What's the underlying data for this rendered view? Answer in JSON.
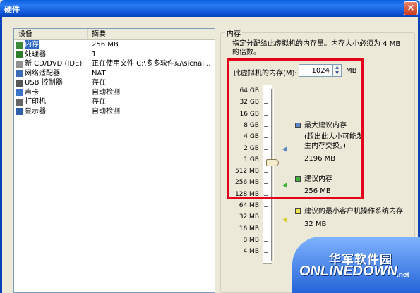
{
  "window": {
    "title": "硬件",
    "close_glyph": "×"
  },
  "device_list": {
    "headers": {
      "device": "设备",
      "summary": "摘要"
    },
    "rows": [
      {
        "icon": "memory-icon",
        "name": "内存",
        "summary": "256 MB",
        "selected": true
      },
      {
        "icon": "processor-icon",
        "name": "处理器",
        "summary": "1"
      },
      {
        "icon": "cd-dvd-icon",
        "name": "新 CD/DVD (IDE)",
        "summary": "正在使用文件 C:\\多多软件站\\sicnal..."
      },
      {
        "icon": "network-adapter-icon",
        "name": "网络适配器",
        "summary": "NAT"
      },
      {
        "icon": "usb-controller-icon",
        "name": "USB 控制器",
        "summary": "存在"
      },
      {
        "icon": "sound-card-icon",
        "name": "声卡",
        "summary": "自动检测"
      },
      {
        "icon": "printer-icon",
        "name": "打印机",
        "summary": "存在"
      },
      {
        "icon": "display-icon",
        "name": "显示器",
        "summary": "自动检测"
      }
    ]
  },
  "memory": {
    "legend": "内存",
    "description": "指定分配给此虚拟机的内存量。内存大小必须为 4 MB 的倍数。",
    "field_label": "此虚拟机的内存(M):",
    "value": "1024",
    "unit": "MB",
    "scale": [
      "64 GB",
      "32 GB",
      "16 GB",
      "8 GB",
      "4 GB",
      "2 GB",
      "1 GB",
      "512 MB",
      "256 MB",
      "128 MB",
      "64 MB",
      "32 MB",
      "16 MB",
      "8 MB",
      "4 MB"
    ],
    "slider_value": "1 GB",
    "max_recommended": {
      "title": "最大建议内存",
      "note": "(超出此大小可能发生内存交换。)",
      "value": "2196 MB"
    },
    "recommended": {
      "title": "建议内存",
      "value": "256 MB"
    },
    "guest_min": {
      "title": "建议的最小客户机操作系统内存",
      "value": "32 MB"
    }
  },
  "watermark": {
    "cn": "华军软件园",
    "en": "ONLINEDOWN",
    "suffix": ".net"
  },
  "colors": {
    "titlebar": "#0a5fe0",
    "highlight_box": "#e3001b",
    "selection": "#316ac5"
  }
}
